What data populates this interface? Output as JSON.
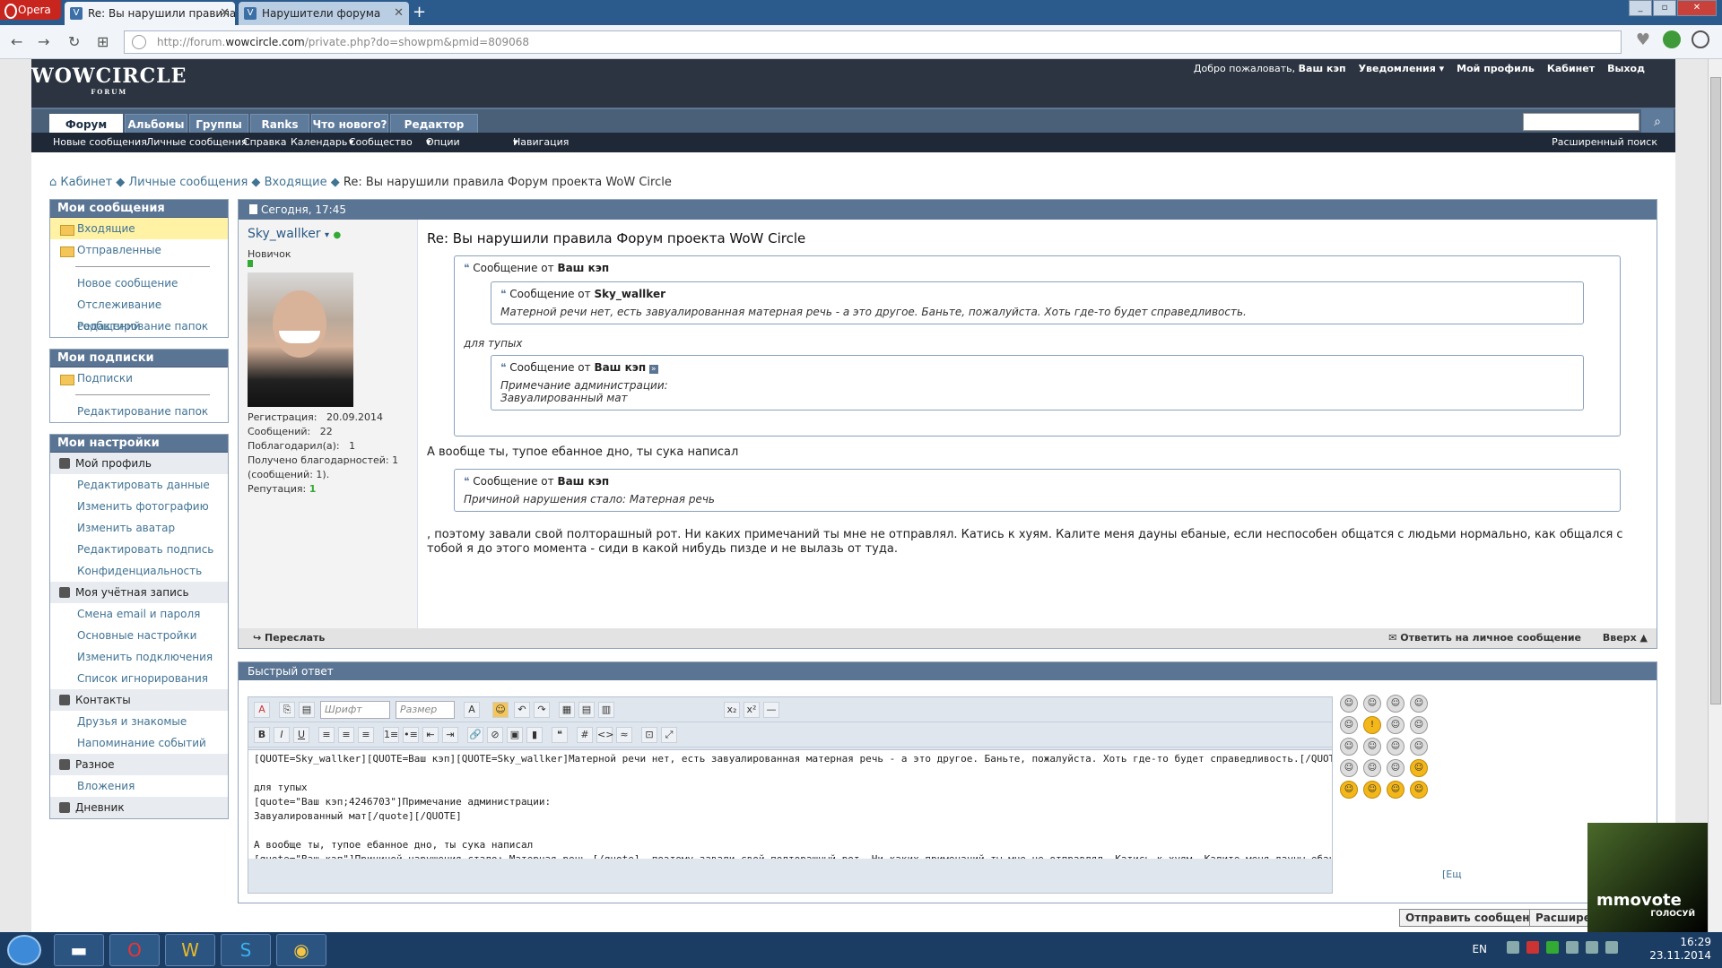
{
  "browser": {
    "menu_label": "Opera",
    "tabs": [
      {
        "label": "Re: Вы нарушили правила",
        "active": true
      },
      {
        "label": "Нарушители форума",
        "active": false
      }
    ],
    "url_prefix": "http://forum.",
    "url_domain": "wowcircle.com",
    "url_path": "/private.php?do=showpm&pmid=809068"
  },
  "site": {
    "logo": "WOWCIRCLE",
    "logo_sub": "FORUM",
    "toplinks": {
      "welcome": "Добро пожаловать,",
      "user": "Ваш кэп",
      "notifications": "Уведомления",
      "profile": "Мой профиль",
      "cabinet": "Кабинет",
      "logout": "Выход"
    },
    "nav_tabs": [
      "Форум",
      "Альбомы",
      "Группы",
      "Ranks",
      "Что нового?",
      "Редактор фото"
    ],
    "subnav": [
      "Новые сообщения",
      "Личные сообщения",
      "Справка",
      "Календарь",
      "Сообщество",
      "Опции форума",
      "Навигация"
    ],
    "advanced_search": "Расширенный поиск"
  },
  "breadcrumb": {
    "items": [
      "Кабинет",
      "Личные сообщения",
      "Входящие"
    ],
    "current": "Re: Вы нарушили правила Форум проекта WoW Circle"
  },
  "sidebar": {
    "messages_title": "Мои сообщения",
    "inbox": "Входящие",
    "sent": "Отправленные",
    "new_message": "Новое сообщение",
    "track": "Отслеживание сообщений",
    "edit_folders": "Редактирование папок",
    "subs_title": "Мои подписки",
    "subs": "Подписки",
    "subs_edit_folders": "Редактирование папок",
    "settings_title": "Мои настройки",
    "my_profile": "Мой профиль",
    "edit_data": "Редактировать данные",
    "change_photo": "Изменить фотографию",
    "change_avatar": "Изменить аватар",
    "edit_signature": "Редактировать подпись",
    "privacy": "Конфиденциальность",
    "account": "Моя учётная запись",
    "change_email": "Смена email и пароля",
    "basic_settings": "Основные настройки",
    "change_connections": "Изменить подключения",
    "ignore_list": "Список игнорирования",
    "contacts": "Контакты",
    "friends": "Друзья и знакомые",
    "event_reminders": "Напоминание событий",
    "misc": "Разное",
    "attachments": "Вложения",
    "diary": "Дневник"
  },
  "post": {
    "date": "Сегодня, 17:45",
    "username": "Sky_wallker",
    "rank": "Новичок",
    "reg_label": "Регистрация:",
    "reg_value": "20.09.2014",
    "posts_label": "Сообщений:",
    "posts_value": "22",
    "thanked_label": "Поблагодарил(а):",
    "thanked_value": "1",
    "received": "Получено благодарностей: 1 (сообщений: 1).",
    "rep_label": "Репутация:",
    "rep_value": "1",
    "title": "Re: Вы нарушили правила Форум проекта WoW Circle",
    "quote_prefix": "Сообщение от",
    "q1_author": "Ваш кэп",
    "q1a_author": "Sky_wallker",
    "q1a_text": "Матерной речи нет, есть завуалированная матерная речь - а это другое. Баньте, пожалуйста. Хоть где-то будет справедливость.",
    "q1_text": "для тупых",
    "q1b_author": "Ваш кэп",
    "q1b_line1": "Примечание администрации:",
    "q1b_line2": "Завуалированный мат",
    "text1": "А вообще ты, тупое ебанное дно, ты сука написал",
    "q2_author": "Ваш кэп",
    "q2_text": "Причиной нарушения стало: Матерная речь",
    "text2": ", поэтому завали свой полторашный рот. Ни каких примечаний ты мне не отправлял. Катись к хуям. Калите меня дауны ебаные, если неспособен общатся с людьми нормально, как общался с тобой я до этого момента - сиди в какой нибудь пизде и не вылазь от туда.",
    "forward": "Переслать",
    "reply": "Ответить на личное сообщение",
    "top": "Вверх"
  },
  "quick_reply": {
    "title": "Быстрый ответ",
    "font_placeholder": "Шрифт",
    "size_placeholder": "Размер",
    "text": "[QUOTE=Sky_wallker][QUOTE=Ваш кэп][QUOTE=Sky_wallker]Матерной речи нет, есть завуалированная матерная речь - а это другое. Баньте, пожалуйста. Хоть где-то будет справедливость.[/QUOTE]\n\nдля тупых\n[quote=\"Ваш кэп;4246703\"]Примечание администрации:\nЗавуалированный мат[/quote][/QUOTE]\n\nА вообще ты, тупое ебанное дно, ты сука написал\n[quote=\"Ваш кэп\"]Причиной нарушения стало: Матерная речь [/quote], поэтому завали свой полторашный рот. Ни каких примечаний ты мне не отправлял. Катись к хуям. Калите меня дауны ебаные, если неспособен общатся с людьми н",
    "more_link": "[Ещ",
    "send": "Отправить сообщение",
    "advanced": "Расширенн"
  },
  "vote_banner": "mmovote",
  "vote_sub": "ГОЛОСУЙ",
  "taskbar": {
    "lang": "EN",
    "time": "16:29",
    "date": "23.11.2014"
  }
}
